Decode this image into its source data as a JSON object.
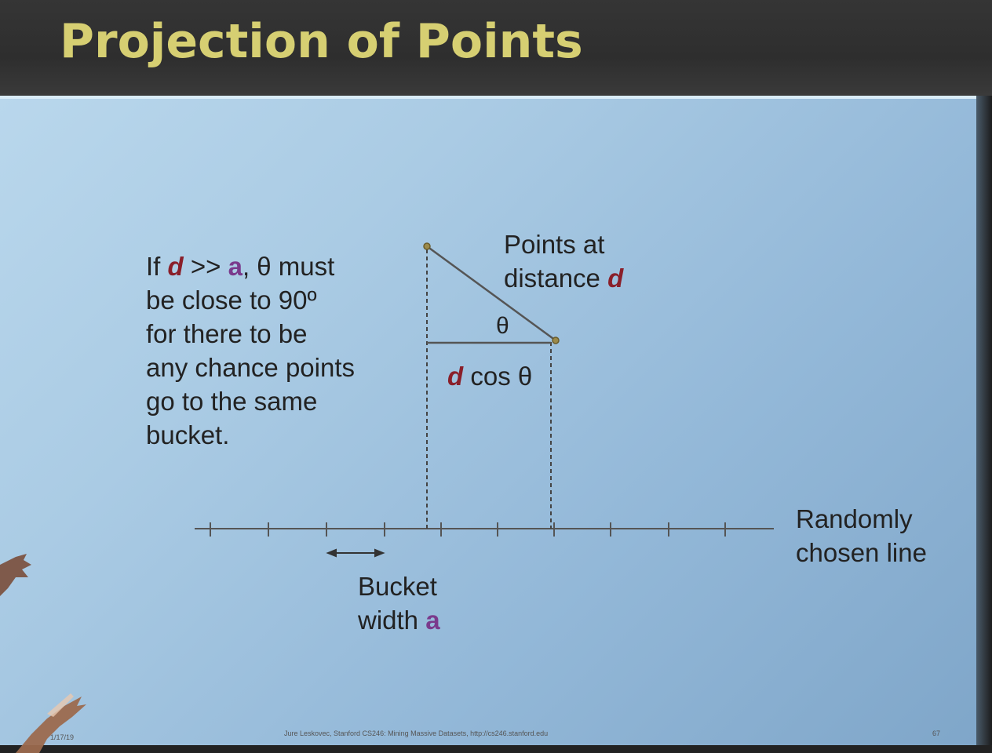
{
  "slide": {
    "title": "Projection of Points",
    "note_lines": [
      [
        "If ",
        "d",
        " >> ",
        "a",
        ", θ must"
      ],
      "be close to 90º",
      "for there to be",
      "any chance points",
      "go to the same",
      "bucket."
    ],
    "points_label_line1": "Points at",
    "points_label_line2_prefix": "distance ",
    "points_label_var": "d",
    "theta": "θ",
    "dcos_var": "d",
    "dcos_rest": " cos θ",
    "line_label_line1": "Randomly",
    "line_label_line2": "chosen line",
    "bucket_label_line1": "Bucket",
    "bucket_label_line2_prefix": "width ",
    "bucket_label_var": "a",
    "footer": "Jure Leskovec, Stanford CS246: Mining Massive Datasets, http://cs246.stanford.edu",
    "date": "1/17/19",
    "page": "67"
  },
  "colors": {
    "title": "#d6cf72",
    "var_d": "#8a1f2a",
    "var_a": "#7a3a8c",
    "slide_bg": "#a9c9e2"
  }
}
